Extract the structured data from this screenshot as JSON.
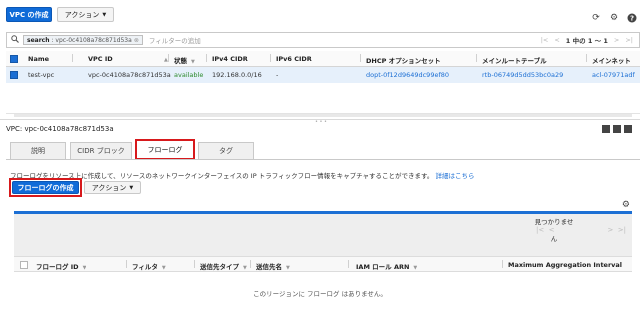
{
  "toolbar": {
    "create_vpc": "VPC の作成",
    "actions": "アクション"
  },
  "search": {
    "chip_label": "search",
    "chip_value": ": vpc-0c4108a78c871d53a",
    "placeholder": "フィルターの追加",
    "pager_text": "1 中の 1 ～ 1"
  },
  "table": {
    "columns": [
      "Name",
      "VPC ID",
      "状態",
      "IPv4 CIDR",
      "IPv6 CIDR",
      "DHCP オプションセット",
      "メインルートテーブル",
      "メインネット"
    ],
    "row": {
      "name": "test-vpc",
      "vpc_id": "vpc-0c4108a78c871d53a",
      "state": "available",
      "ipv4": "192.168.0.0/16",
      "ipv6": "-",
      "dhcp": "dopt-0f12d9649dc99ef80",
      "route_table": "rtb-06749d5dd53bc0a29",
      "acl": "acl-07971adf"
    }
  },
  "detail": {
    "title": "VPC: vpc-0c4108a78c871d53a",
    "tabs": [
      "説明",
      "CIDR ブロック",
      "フローログ",
      "タグ"
    ],
    "description": "フローログをリソース上に作成して、リソースのネットワークインターフェイスの IP トラフィックフロー情報をキャプチャすることができます。",
    "learn_more": "詳細はこちら",
    "create_flow_log": "フローログの作成",
    "actions": "アクション",
    "not_found_line1": "見つかりませ",
    "not_found_line2": "ん",
    "flow_columns": [
      "フローログ ID",
      "フィルタ",
      "送信先タイプ",
      "送信先名",
      "IAM ロール ARN",
      "Maximum Aggregation Interval"
    ],
    "empty_message": "このリージョンに フローログ はありません。"
  },
  "colors": {
    "primary": "#0f6bd8",
    "available": "#2e8b2e",
    "link": "#1c6fd4",
    "highlight": "#d7191c"
  }
}
